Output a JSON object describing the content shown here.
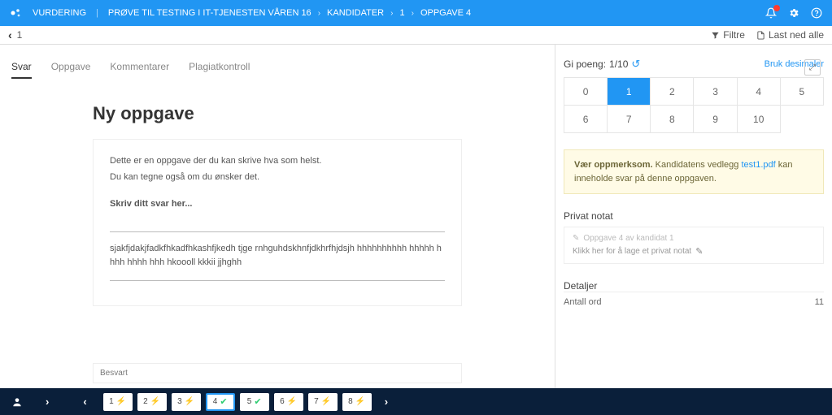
{
  "topbar": {
    "breadcrumb": [
      "VURDERING",
      "PRØVE TIL TESTING I IT-TJENESTEN VÅREN 16",
      "KANDIDATER",
      "1",
      "OPPGAVE 4"
    ]
  },
  "subbar": {
    "back_number": "1",
    "filter_label": "Filtre",
    "download_label": "Last ned alle"
  },
  "left": {
    "tabs": {
      "svar": "Svar",
      "oppgave": "Oppgave",
      "kommentarer": "Kommentarer",
      "plagiatkontroll": "Plagiatkontroll"
    },
    "doc": {
      "title": "Ny oppgave",
      "line1": "Dette er en oppgave der du kan skrive hva som helst.",
      "line2": "Du kan tegne også om du ønsker det.",
      "prompt": "Skriv ditt svar her...",
      "answer": "sjakfjdakjfadkfhkadfhkashfjkedh tjge rnhguhdskhnfjdkhrfhjdsjh hhhhhhhhhh hhhhh hhhh hhhh hhh hkoooll kkkii jjhghh"
    },
    "status": "Besvart"
  },
  "right": {
    "score_label": "Gi poeng:",
    "score_value": "1/10",
    "decimals_label": "Bruk desimaler",
    "scores": [
      "0",
      "1",
      "2",
      "3",
      "4",
      "5",
      "6",
      "7",
      "8",
      "9",
      "10"
    ],
    "active_score_index": 1,
    "alert_bold": "Vær oppmerksom.",
    "alert_text1": " Kandidatens vedlegg ",
    "alert_link": "test1.pdf",
    "alert_text2": " kan inneholde svar på denne oppgaven.",
    "private_note_title": "Privat notat",
    "note_line1": "Oppgave 4 av kandidat 1",
    "note_line2": "Klikk her for å lage et privat notat",
    "details_title": "Detaljer",
    "details_label": "Antall ord",
    "details_value": "11"
  },
  "bottom": {
    "pages": [
      {
        "num": "1",
        "icon": "bolt"
      },
      {
        "num": "2",
        "icon": "bolt"
      },
      {
        "num": "3",
        "icon": "bolt"
      },
      {
        "num": "4",
        "icon": "check",
        "current": true
      },
      {
        "num": "5",
        "icon": "check"
      },
      {
        "num": "6",
        "icon": "bolt"
      },
      {
        "num": "7",
        "icon": "bolt"
      },
      {
        "num": "8",
        "icon": "bolt"
      }
    ]
  }
}
